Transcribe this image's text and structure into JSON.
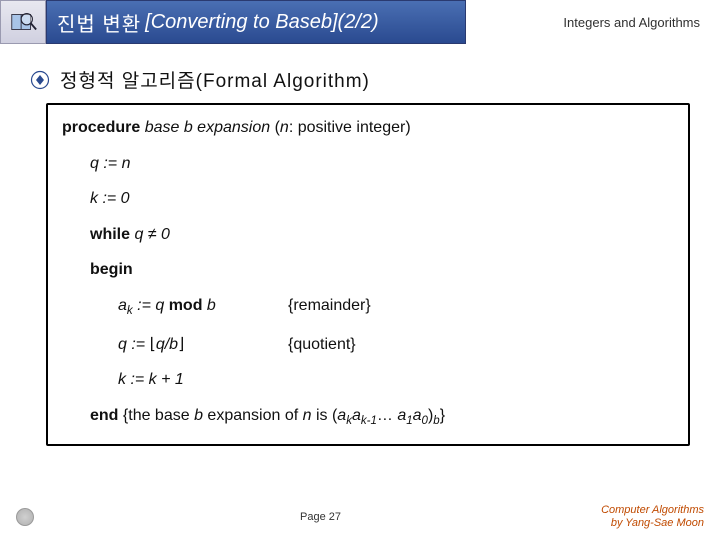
{
  "header": {
    "title_korean": "진법 변환",
    "title_bracket_open": "[",
    "title_conv": "Converting to Base ",
    "title_bvar": "b",
    "title_bracket_close": "]",
    "title_page": " (2/2)",
    "chapter": "Integers and Algorithms"
  },
  "section": {
    "title": "정형적 알고리즘(Formal Algorithm)"
  },
  "algo": {
    "proc_kw": "procedure",
    "proc_name": " base b expansion ",
    "proc_args": "(n: positive integer)",
    "l1_lhs": "q := n",
    "l2_lhs": "k := 0",
    "l3_kw": "while",
    "l3_cond_a": " q ",
    "l3_neq": "≠",
    "l3_cond_b": " 0",
    "l4_kw": "begin",
    "l5_a": "a",
    "l5_sub": "k",
    "l5_rest": " := q ",
    "l5_mod": "mod",
    "l5_b": " b",
    "l5_note": "{remainder}",
    "l6_lhs_a": "q := ",
    "l6_floor_l": "⌊",
    "l6_qb": "q/b",
    "l6_floor_r": "⌋",
    "l6_note": "{quotient}",
    "l7_lhs": "k := k + 1",
    "l8_kw": "end",
    "l8_open": " {the base ",
    "l8_b": "b",
    "l8_exp": " expansion of ",
    "l8_n": "n",
    "l8_is": " is (",
    "l8_a1": "a",
    "l8_s1": "k",
    "l8_a2": "a",
    "l8_s2": "k-1",
    "l8_dots": "… ",
    "l8_a3": "a",
    "l8_s3": "1",
    "l8_a4": "a",
    "l8_s4": "0",
    "l8_close": ")",
    "l8_sb": "b",
    "l8_brace": "}"
  },
  "footer": {
    "uni": "",
    "page": "Page 27",
    "credit1": "Computer Algorithms",
    "credit2": "by Yang-Sae Moon"
  }
}
